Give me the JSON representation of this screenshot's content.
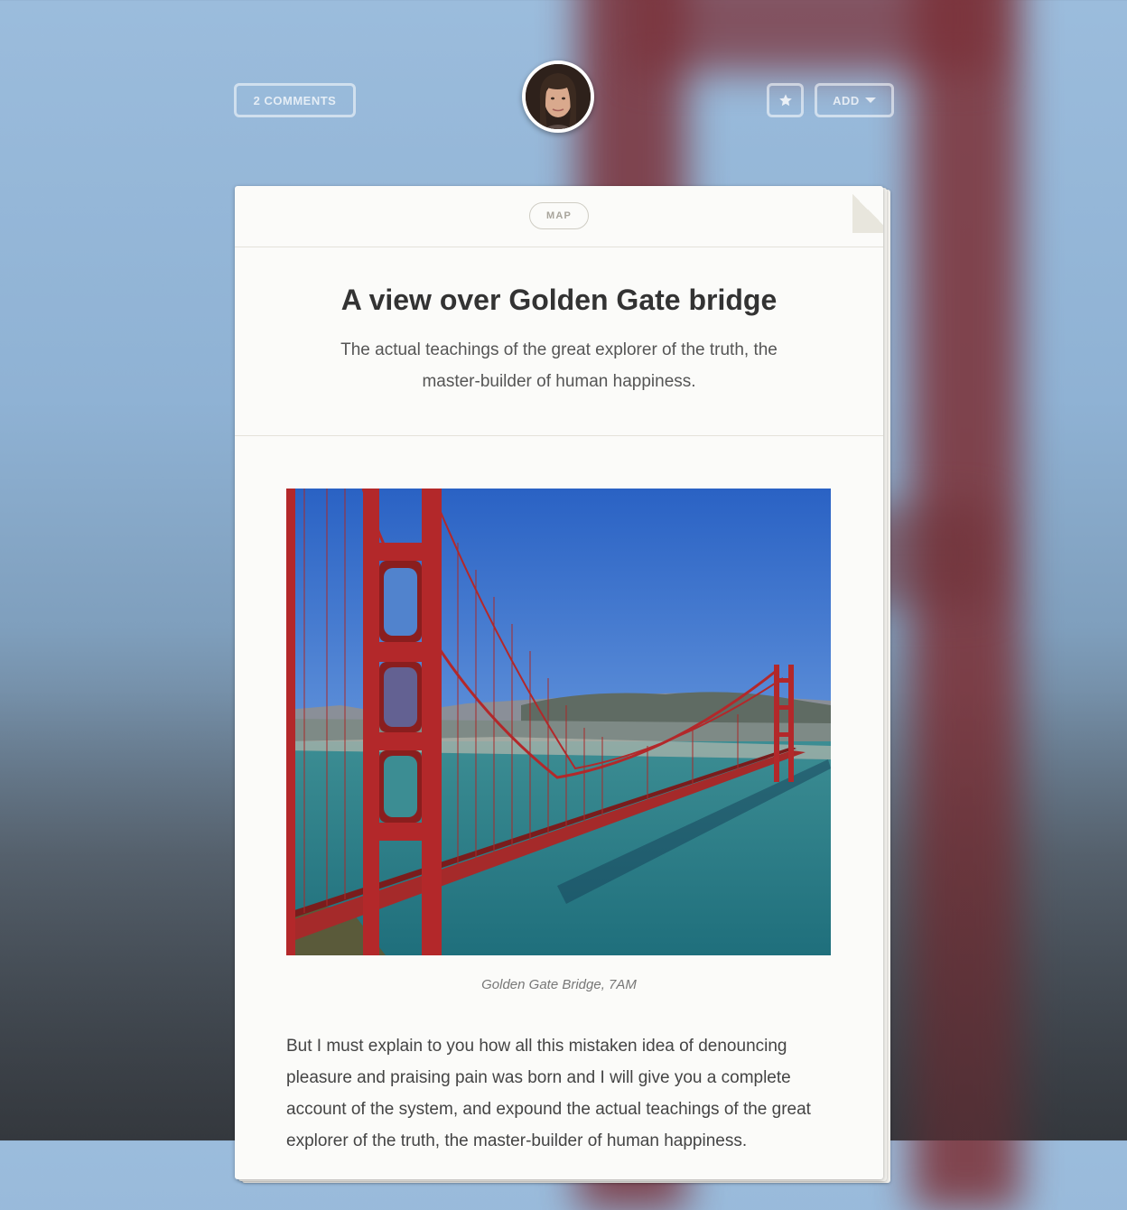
{
  "header": {
    "comments_label": "2 COMMENTS",
    "add_label": "ADD"
  },
  "post": {
    "category": "MAP",
    "title": "A view over Golden Gate bridge",
    "subtitle": "The actual teachings of the great explorer of the truth, the master-builder of human happiness.",
    "image_caption": "Golden Gate Bridge, 7AM",
    "body": "But I must explain to you how all this mistaken idea of denouncing pleasure and praising pain was born and I will give you a complete account of the system, and expound the actual teachings of the great explorer of the truth, the master-builder of human happiness."
  },
  "colors": {
    "bridge_red": "#b3282a",
    "sky_blue": "#2f6fc7",
    "water": "#2f7f86"
  }
}
